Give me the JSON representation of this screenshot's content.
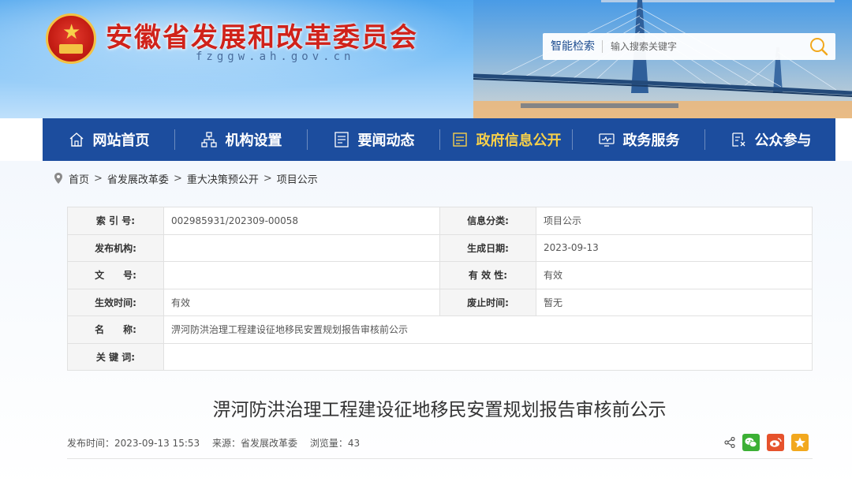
{
  "header": {
    "site_title": "安徽省发展和改革委员会",
    "site_domain": "fzggw.ah.gov.cn",
    "search_label": "智能检索",
    "search_placeholder": "输入搜索关键字"
  },
  "nav": {
    "items": [
      {
        "label": "网站首页",
        "icon": "home-icon"
      },
      {
        "label": "机构设置",
        "icon": "org-chart-icon"
      },
      {
        "label": "要闻动态",
        "icon": "news-icon"
      },
      {
        "label": "政府信息公开",
        "icon": "info-disclosure-icon",
        "active": true
      },
      {
        "label": "政务服务",
        "icon": "monitor-icon"
      },
      {
        "label": "公众参与",
        "icon": "feedback-icon"
      }
    ],
    "active_color": "#f7d04a"
  },
  "breadcrumb": [
    "首页",
    "省发展改革委",
    "重大决策预公开",
    "项目公示"
  ],
  "meta": {
    "index_key": "索 引 号:",
    "index_val": "002985931/202309-00058",
    "category_key": "信息分类:",
    "category_val": "项目公示",
    "publisher_key": "发布机构:",
    "publisher_val": "",
    "created_key": "生成日期:",
    "created_val": "2023-09-13",
    "docno_key": "文　　号:",
    "docno_val": "",
    "validity_key": "有 效 性:",
    "validity_val": "有效",
    "effective_key": "生效时间:",
    "effective_val": "有效",
    "expire_key": "废止时间:",
    "expire_val": "暂无",
    "name_key": "名　　称:",
    "name_val": "淠河防洪治理工程建设征地移民安置规划报告审核前公示",
    "keywords_key": "关 键 词:",
    "keywords_val": ""
  },
  "article": {
    "title": "淠河防洪治理工程建设征地移民安置规划报告审核前公示",
    "publish_time": "发布时间：2023-09-13 15:53",
    "source": "来源：省发展改革委",
    "views": "浏览量：43"
  },
  "colors": {
    "nav_bg": "#1c4d9e",
    "title_red": "#d0221a",
    "wechat": "#3cb035",
    "weibo": "#e6522c",
    "favorite": "#f2a81d"
  }
}
